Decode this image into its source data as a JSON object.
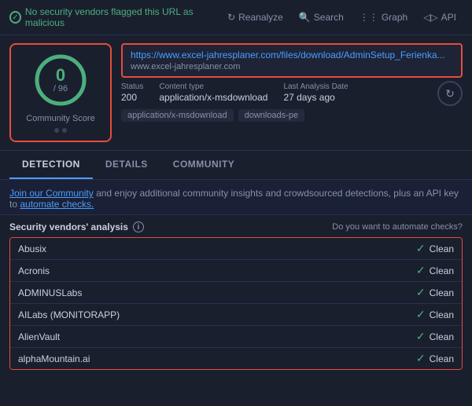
{
  "topbar": {
    "safe_message": "No security vendors flagged this URL as malicious",
    "reanalyze_label": "Reanalyze",
    "search_label": "Search",
    "graph_label": "Graph",
    "api_label": "API"
  },
  "score_card": {
    "score": "0",
    "denominator": "/ 96",
    "label": "Community Score"
  },
  "url_info": {
    "url": "https://www.excel-jahresplaner.com/files/download/AdminSetup_Ferienka...",
    "domain": "www.excel-jahresplaner.com",
    "status_label": "Status",
    "status_value": "200",
    "content_type_label": "Content type",
    "content_type_value": "application/x-msdownload",
    "last_analysis_label": "Last Analysis Date",
    "last_analysis_value": "27 days ago",
    "tags": [
      "application/x-msdownload",
      "downloads-pe"
    ]
  },
  "tabs": [
    {
      "label": "DETECTION",
      "active": true
    },
    {
      "label": "DETAILS",
      "active": false
    },
    {
      "label": "COMMUNITY",
      "active": false
    }
  ],
  "community_bar": {
    "text_before": "",
    "link1": "Join our Community",
    "text_middle": " and enjoy additional community insights and crowdsourced detections, plus an API key to ",
    "link2": "automate checks.",
    "text_after": ""
  },
  "analysis": {
    "title": "Security vendors' analysis",
    "automate_label": "Do you want to automate checks?",
    "vendors": [
      {
        "name": "Abusix",
        "status": "Clean"
      },
      {
        "name": "Acronis",
        "status": "Clean"
      },
      {
        "name": "ADMINUSLabs",
        "status": "Clean"
      },
      {
        "name": "AILabs (MONITORAPP)",
        "status": "Clean"
      },
      {
        "name": "AlienVault",
        "status": "Clean"
      },
      {
        "name": "alphaMountain.ai",
        "status": "Clean"
      }
    ]
  }
}
